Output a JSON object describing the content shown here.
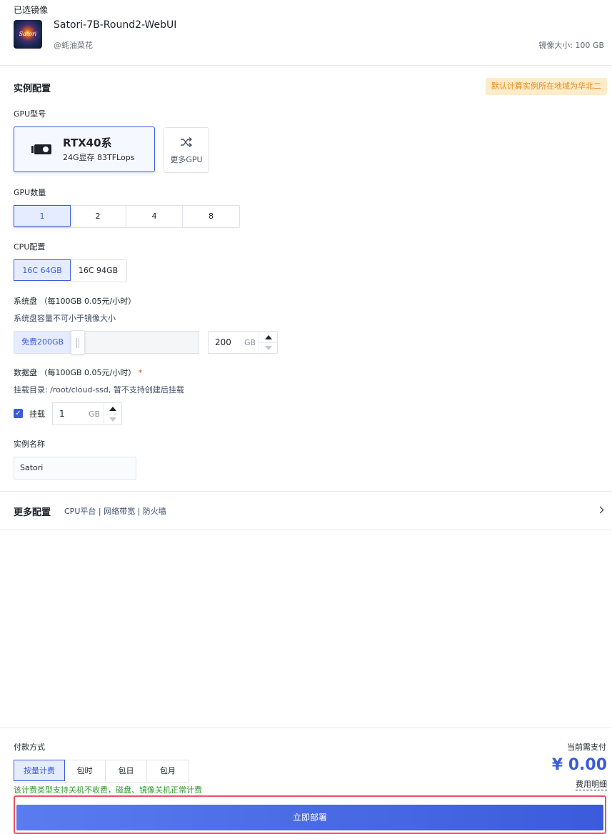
{
  "image": {
    "section_label": "已选镜像",
    "thumb_text": "Satori",
    "name": "Satori-7B-Round2-WebUI",
    "author": "@蚝油菜花",
    "size": "镜像大小: 100 GB"
  },
  "instance": {
    "title": "实例配置",
    "region_badge": "默认计算实例所在地域为华北二",
    "gpu_model_label": "GPU型号",
    "gpu_card": {
      "name": "RTX40系",
      "spec": "24G显存 83TFLops"
    },
    "gpu_more_label": "更多GPU",
    "gpu_count_label": "GPU数量",
    "gpu_counts": [
      "1",
      "2",
      "4",
      "8"
    ],
    "gpu_count_selected": "1",
    "cpu_label": "CPU配置",
    "cpu_options": [
      "16C 64GB",
      "16C 94GB"
    ],
    "cpu_selected": "16C 64GB",
    "sys_disk_label": "系统盘 （每100GB 0.05元/小时）",
    "sys_disk_hint": "系统盘容量不可小于镜像大小",
    "sys_disk_free": "免费200GB",
    "sys_disk_value": "200",
    "sys_disk_unit": "GB",
    "data_disk_label": "数据盘 （每100GB 0.05元/小时）",
    "data_disk_required": "*",
    "data_disk_hint": "挂载目录: /root/cloud-ssd, 暂不支持创建后挂载",
    "mount_label": "挂载",
    "data_disk_value": "1",
    "data_disk_unit": "GB",
    "name_label": "实例名称",
    "name_value": "Satori"
  },
  "more_config": {
    "title": "更多配置",
    "sub": "CPU平台 | 网络带宽 | 防火墙"
  },
  "payment": {
    "label": "付款方式",
    "options": [
      "按量计费",
      "包时",
      "包日",
      "包月"
    ],
    "selected": "按量计费",
    "note": "该计费类型支持关机不收费，磁盘、镜像关机正常计费",
    "need_pay_label": "当前需支付",
    "price": "¥ 0.00",
    "fee_detail": "费用明细",
    "deploy_label": "立即部署"
  },
  "colors": {
    "accent": "#3b5bdb",
    "badge_bg": "#fdebc9",
    "badge_text": "#e68a1c",
    "note_green": "#2e9b2e",
    "highlight_red": "#e8515f"
  }
}
